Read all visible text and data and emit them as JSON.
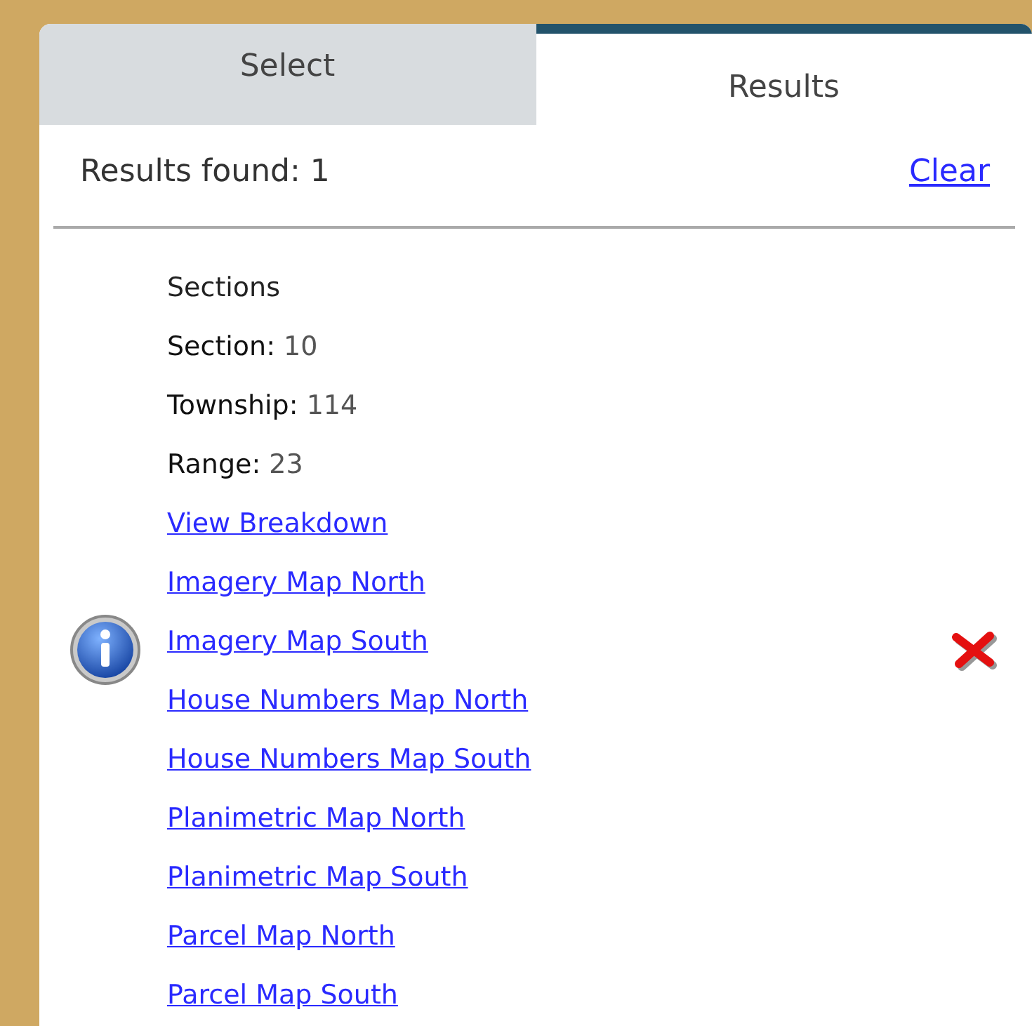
{
  "tabs": [
    {
      "label": "Select",
      "selected": false
    },
    {
      "label": "Results",
      "selected": true
    }
  ],
  "summary": {
    "text": "Results found: 1",
    "clear_link": "Clear"
  },
  "result": {
    "lines": [
      {
        "kind": "title",
        "text": "Sections"
      },
      {
        "kind": "field",
        "label": "Section:",
        "value": "10"
      },
      {
        "kind": "field",
        "label": "Township:",
        "value": "114"
      },
      {
        "kind": "field",
        "label": "Range:",
        "value": "23"
      },
      {
        "kind": "link",
        "text": "View Breakdown"
      },
      {
        "kind": "link",
        "text": "Imagery Map North"
      },
      {
        "kind": "link",
        "text": "Imagery Map South"
      },
      {
        "kind": "link",
        "text": "House Numbers Map North"
      },
      {
        "kind": "link",
        "text": "House Numbers Map South"
      },
      {
        "kind": "link",
        "text": "Planimetric Map North"
      },
      {
        "kind": "link",
        "text": "Planimetric Map South"
      },
      {
        "kind": "link",
        "text": "Parcel Map North"
      },
      {
        "kind": "link",
        "text": "Parcel Map South"
      }
    ]
  }
}
